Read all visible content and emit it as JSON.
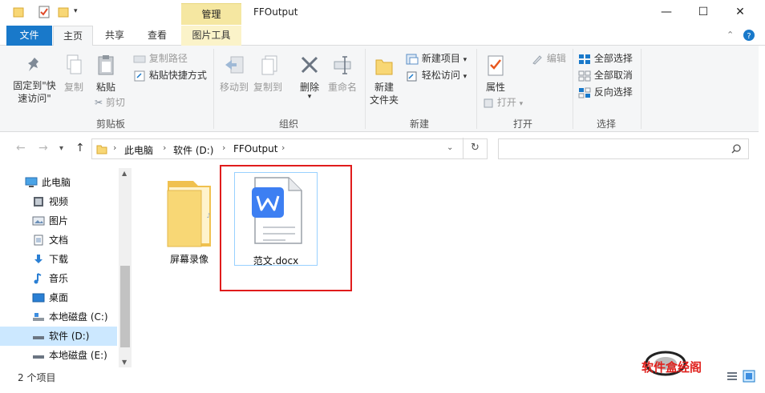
{
  "window": {
    "title": "FFOutput",
    "contextual_tab_group": "管理",
    "controls": {
      "minimize": "—",
      "maximize": "☐",
      "close": "✕"
    }
  },
  "ribbon_tabs": [
    "文件",
    "主页",
    "共享",
    "查看",
    "图片工具"
  ],
  "ribbon": {
    "clipboard": {
      "pin_label_line1": "固定到\"快",
      "pin_label_line2": "速访问\"",
      "copy": "复制",
      "paste": "粘贴",
      "copy_path": "复制路径",
      "paste_shortcut": "粘贴快捷方式",
      "cut": "剪切",
      "group": "剪贴板"
    },
    "organize": {
      "move_to": "移动到",
      "copy_to": "复制到",
      "delete": "删除",
      "rename": "重命名",
      "group": "组织"
    },
    "new": {
      "new_folder_line1": "新建",
      "new_folder_line2": "文件夹",
      "new_item": "新建项目",
      "easy_access": "轻松访问",
      "group": "新建"
    },
    "open": {
      "properties": "属性",
      "open": "打开",
      "edit": "编辑",
      "group": "打开"
    },
    "select": {
      "select_all": "全部选择",
      "select_none": "全部取消",
      "invert": "反向选择",
      "group": "选择"
    }
  },
  "address": {
    "crumbs": [
      "此电脑",
      "软件 (D:)",
      "FFOutput"
    ],
    "search_placeholder": ""
  },
  "nav_pane": {
    "items": [
      {
        "label": "此电脑",
        "icon": "computer-icon"
      },
      {
        "label": "视频",
        "icon": "video-folder-icon"
      },
      {
        "label": "图片",
        "icon": "pictures-folder-icon"
      },
      {
        "label": "文档",
        "icon": "documents-folder-icon"
      },
      {
        "label": "下载",
        "icon": "downloads-folder-icon"
      },
      {
        "label": "音乐",
        "icon": "music-folder-icon"
      },
      {
        "label": "桌面",
        "icon": "desktop-folder-icon"
      },
      {
        "label": "本地磁盘 (C:)",
        "icon": "drive-icon"
      },
      {
        "label": "软件 (D:)",
        "icon": "drive-icon"
      },
      {
        "label": "本地磁盘 (E:)",
        "icon": "drive-icon"
      }
    ]
  },
  "files": [
    {
      "name": "屏幕录像",
      "type": "folder"
    },
    {
      "name": "范文.docx",
      "type": "wps-document"
    }
  ],
  "status": {
    "item_count": "2 个项目"
  },
  "watermark": {
    "text": "软件盒经阁"
  },
  "colors": {
    "accent": "#1979ca",
    "contextual_tab": "#f5e7a1",
    "highlight": "#e01c1c",
    "selection": "#cce8ff"
  }
}
